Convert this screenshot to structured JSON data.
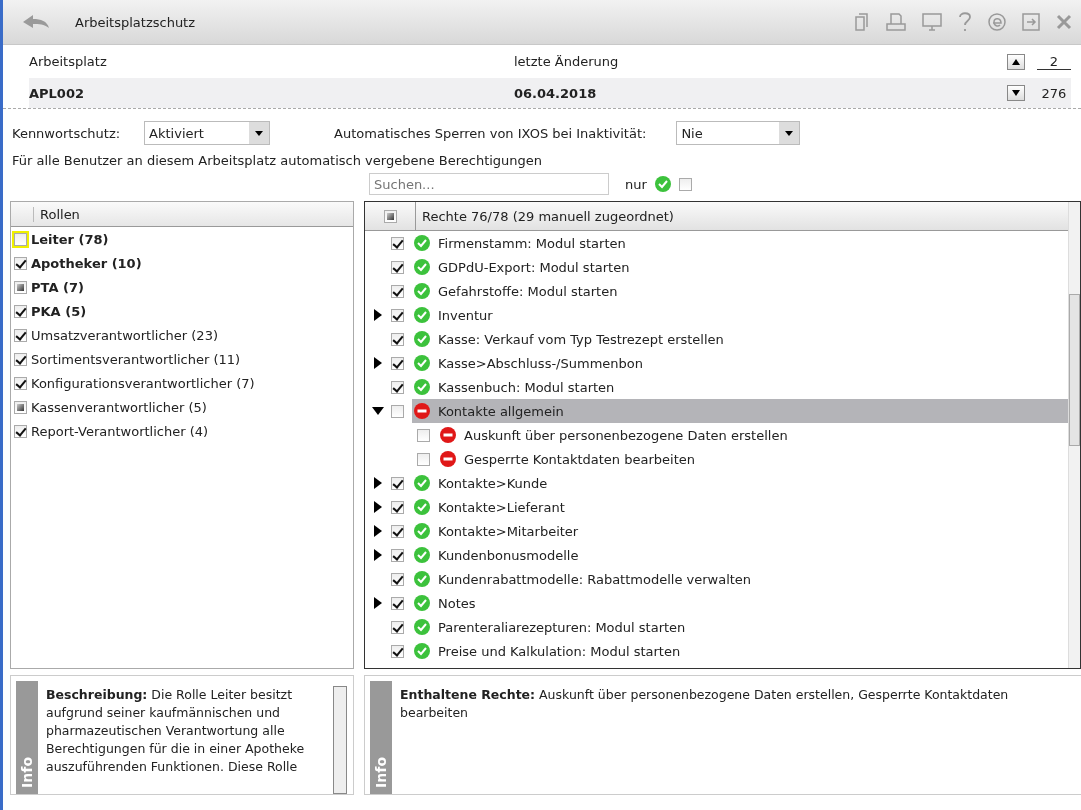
{
  "window": {
    "title": "Arbeitsplatzschutz"
  },
  "header": {
    "columns": [
      "Arbeitsplatz",
      "letzte Änderung"
    ],
    "values": [
      "APL002",
      "06.04.2018"
    ],
    "pager": {
      "current": "2",
      "total": "276"
    }
  },
  "settings": {
    "password_label": "Kennwortschutz:",
    "password_value": "Aktiviert",
    "lock_label": "Automatisches Sperren von IXOS bei Inaktivität:",
    "lock_value": "Nie"
  },
  "section_label": "Für alle Benutzer an diesem Arbeitsplatz automatisch vergebene Berechtigungen",
  "search": {
    "placeholder": "Suchen...",
    "filter_label": "nur",
    "filter_checked": false
  },
  "roles": {
    "header": "Rollen",
    "items": [
      {
        "label": "Leiter (78)",
        "bold": true,
        "checked": false,
        "partial": false,
        "selected": true
      },
      {
        "label": "Apotheker (10)",
        "bold": true,
        "checked": true,
        "partial": false,
        "selected": false
      },
      {
        "label": "PTA (7)",
        "bold": true,
        "checked": false,
        "partial": true,
        "selected": false
      },
      {
        "label": "PKA (5)",
        "bold": true,
        "checked": true,
        "partial": false,
        "selected": false
      },
      {
        "label": "Umsatzverantwortlicher (23)",
        "bold": false,
        "checked": true,
        "partial": false,
        "selected": false
      },
      {
        "label": "Sortimentsverantwortlicher (11)",
        "bold": false,
        "checked": true,
        "partial": false,
        "selected": false
      },
      {
        "label": "Konfigurationsverantwortlicher (7)",
        "bold": false,
        "checked": true,
        "partial": false,
        "selected": false
      },
      {
        "label": "Kassenverantwortlicher (5)",
        "bold": false,
        "checked": false,
        "partial": true,
        "selected": false
      },
      {
        "label": "Report-Verantwortlicher (4)",
        "bold": false,
        "checked": true,
        "partial": false,
        "selected": false
      }
    ]
  },
  "rights": {
    "header": "Rechte 76/78 (29 manuell zugeordnet)",
    "header_checked": false,
    "header_partial": true,
    "items": [
      {
        "kind": "leaf",
        "label": "Firmenstamm: Modul starten",
        "checked": true,
        "allowed": true,
        "selected": false
      },
      {
        "kind": "leaf",
        "label": "GDPdU-Export: Modul starten",
        "checked": true,
        "allowed": true,
        "selected": false
      },
      {
        "kind": "leaf",
        "label": "Gefahrstoffe: Modul starten",
        "checked": true,
        "allowed": true,
        "selected": false
      },
      {
        "kind": "group",
        "label": "Inventur",
        "checked": true,
        "allowed": true,
        "expanded": false,
        "selected": false
      },
      {
        "kind": "leaf",
        "label": "Kasse: Verkauf vom Typ Testrezept erstellen",
        "checked": true,
        "allowed": true,
        "selected": false
      },
      {
        "kind": "group",
        "label": "Kasse>Abschluss-/Summenbon",
        "checked": true,
        "allowed": true,
        "expanded": false,
        "selected": false
      },
      {
        "kind": "leaf",
        "label": "Kassenbuch: Modul starten",
        "checked": true,
        "allowed": true,
        "selected": false
      },
      {
        "kind": "group",
        "label": "Kontakte allgemein",
        "checked": false,
        "allowed": false,
        "expanded": true,
        "selected": true,
        "children": [
          {
            "label": "Auskunft über personenbezogene Daten erstellen",
            "checked": false,
            "allowed": false,
            "selected": false
          },
          {
            "label": "Gesperrte Kontaktdaten bearbeiten",
            "checked": false,
            "allowed": false,
            "selected": false
          }
        ]
      },
      {
        "kind": "group",
        "label": "Kontakte>Kunde",
        "checked": true,
        "allowed": true,
        "expanded": false,
        "selected": false
      },
      {
        "kind": "group",
        "label": "Kontakte>Lieferant",
        "checked": true,
        "allowed": true,
        "expanded": false,
        "selected": false
      },
      {
        "kind": "group",
        "label": "Kontakte>Mitarbeiter",
        "checked": true,
        "allowed": true,
        "expanded": false,
        "selected": false
      },
      {
        "kind": "group",
        "label": "Kundenbonusmodelle",
        "checked": true,
        "allowed": true,
        "expanded": false,
        "selected": false
      },
      {
        "kind": "leaf",
        "label": "Kundenrabattmodelle: Rabattmodelle verwalten",
        "checked": true,
        "allowed": true,
        "selected": false
      },
      {
        "kind": "group",
        "label": "Notes",
        "checked": true,
        "allowed": true,
        "expanded": false,
        "selected": false
      },
      {
        "kind": "leaf",
        "label": "Parenteraliarezepturen: Modul starten",
        "checked": true,
        "allowed": true,
        "selected": false
      },
      {
        "kind": "leaf",
        "label": "Preise und Kalkulation: Modul starten",
        "checked": true,
        "allowed": true,
        "selected": false
      }
    ]
  },
  "info_left": {
    "tab": "Info",
    "text": "**Beschreibung:** Die Rolle Leiter besitzt aufgrund seiner kaufmännischen und pharmazeutischen Verantwortung alle Berechtigungen für die in einer Apotheke auszuführenden Funktionen. Diese Rolle"
  },
  "info_right": {
    "tab": "Info",
    "text": "**Enthaltene Rechte:** Auskunft über personenbezogene Daten erstellen, Gesperrte Kontaktdaten bearbeiten"
  }
}
